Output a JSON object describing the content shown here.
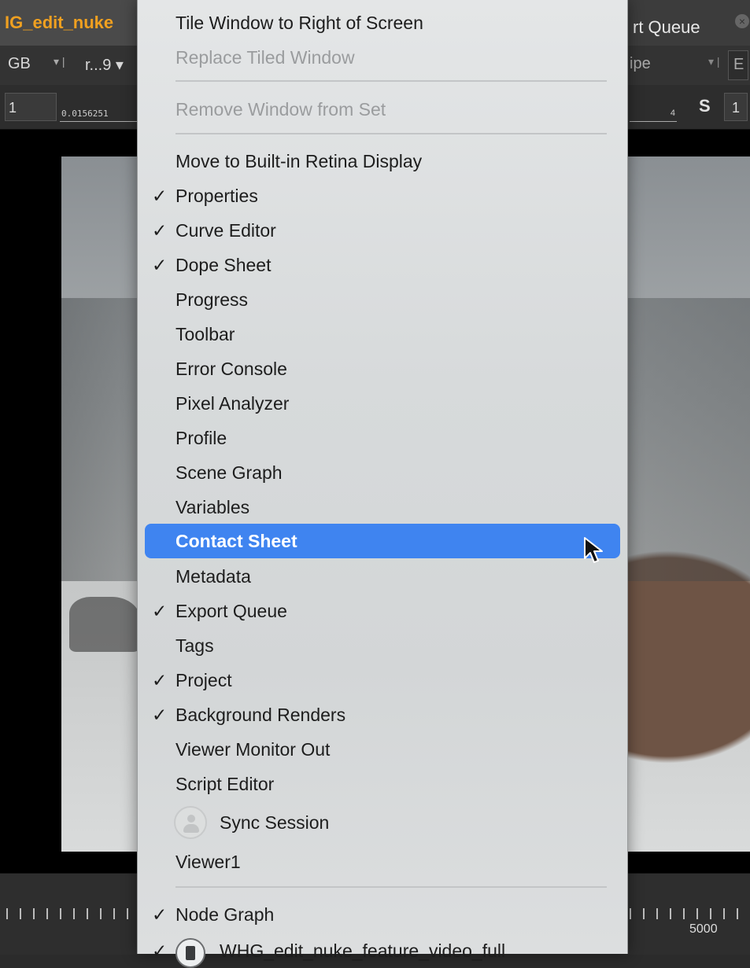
{
  "background": {
    "tab_left_title": "IG_edit_nuke",
    "tab_right_title": "rt Queue",
    "tab_close": "×",
    "toolbar_left_label": "GB",
    "toolbar_mid_label": "r...9",
    "toolbar_right_label": "ipe",
    "toolbar_right_letter": "E",
    "frame_box_value": "1",
    "ruler_left_value": "0.0156251",
    "ruler_right_value": "4",
    "s_label": "S",
    "s_value": "1",
    "timeline_number": "5000"
  },
  "menu": {
    "items": [
      {
        "label": "Tile Window to Right of Screen",
        "checked": false,
        "enabled": true
      },
      {
        "label": "Replace Tiled Window",
        "checked": false,
        "enabled": false
      },
      {
        "label": "Remove Window from Set",
        "checked": false,
        "enabled": false
      },
      {
        "label": "Move to Built-in Retina Display",
        "checked": false,
        "enabled": true
      },
      {
        "label": "Properties",
        "checked": true,
        "enabled": true
      },
      {
        "label": "Curve Editor",
        "checked": true,
        "enabled": true
      },
      {
        "label": "Dope Sheet",
        "checked": true,
        "enabled": true
      },
      {
        "label": "Progress",
        "checked": false,
        "enabled": true
      },
      {
        "label": "Toolbar",
        "checked": false,
        "enabled": true
      },
      {
        "label": "Error Console",
        "checked": false,
        "enabled": true
      },
      {
        "label": "Pixel Analyzer",
        "checked": false,
        "enabled": true
      },
      {
        "label": "Profile",
        "checked": false,
        "enabled": true
      },
      {
        "label": "Scene Graph",
        "checked": false,
        "enabled": true
      },
      {
        "label": "Variables",
        "checked": false,
        "enabled": true
      },
      {
        "label": "Contact Sheet",
        "checked": false,
        "enabled": true,
        "highlighted": true
      },
      {
        "label": "Metadata",
        "checked": false,
        "enabled": true
      },
      {
        "label": "Export Queue",
        "checked": true,
        "enabled": true
      },
      {
        "label": "Tags",
        "checked": false,
        "enabled": true
      },
      {
        "label": "Project",
        "checked": true,
        "enabled": true
      },
      {
        "label": "Background Renders",
        "checked": true,
        "enabled": true
      },
      {
        "label": "Viewer Monitor Out",
        "checked": false,
        "enabled": true
      },
      {
        "label": "Script Editor",
        "checked": false,
        "enabled": true
      },
      {
        "label": "Sync Session",
        "checked": false,
        "enabled": true,
        "icon": "sync-session-icon"
      },
      {
        "label": "Viewer1",
        "checked": false,
        "enabled": true
      },
      {
        "label": "Node Graph",
        "checked": true,
        "enabled": true
      },
      {
        "label": "WHG_edit_nuke_feature_video_full",
        "checked": true,
        "enabled": true,
        "icon": "nuke-script-icon"
      }
    ],
    "check_glyph": "✓",
    "highlight_color": "#3f84f0"
  }
}
